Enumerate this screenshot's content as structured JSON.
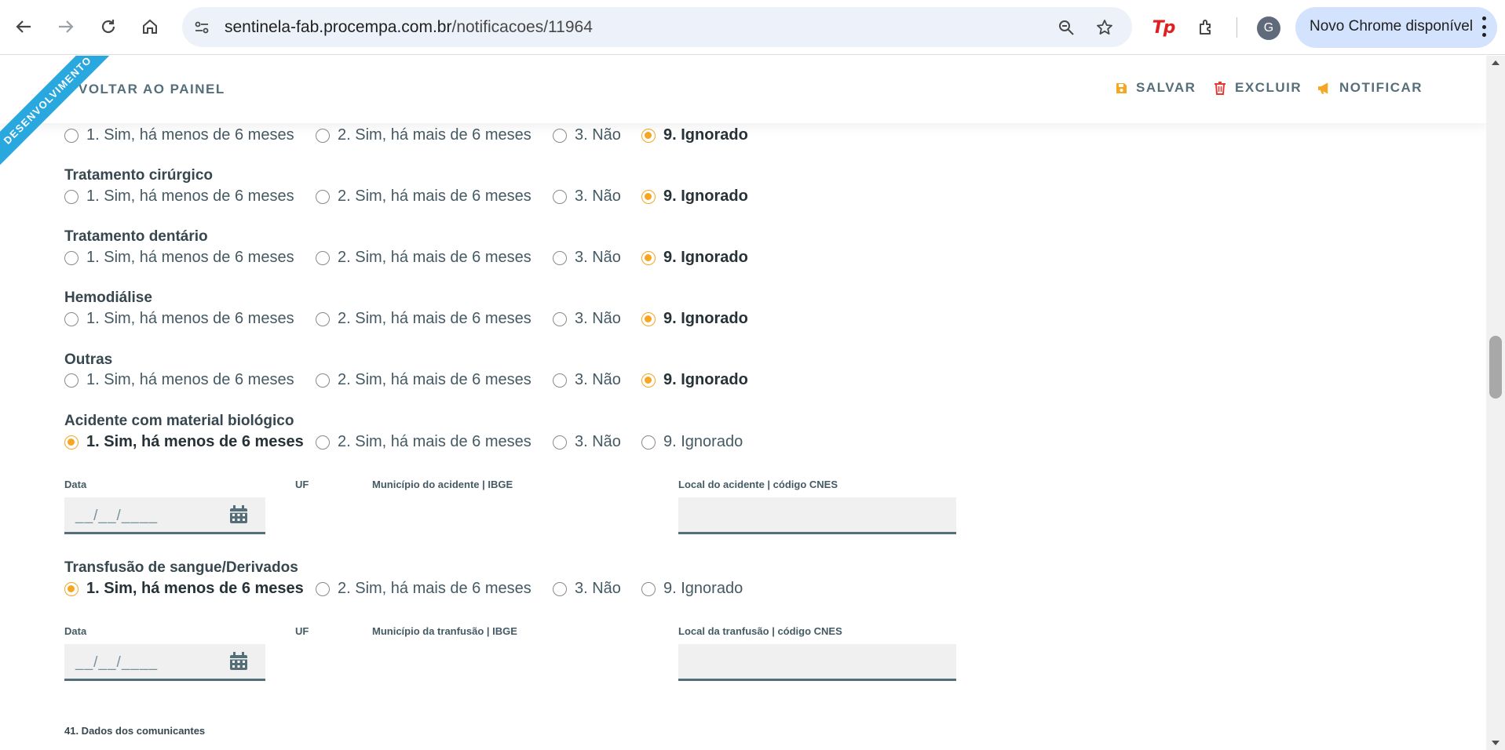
{
  "browser": {
    "url_host": "sentinela-fab.procempa.com.br",
    "url_path": "/notificacoes/11964",
    "update_label": "Novo Chrome disponível",
    "profile_initial": "G",
    "extension_label": "Tp"
  },
  "header": {
    "ribbon": "DESENVOLVIMENTO",
    "back_label": "VOLTAR AO PAINEL",
    "save_label": "SALVAR",
    "delete_label": "EXCLUIR",
    "notify_label": "NOTIFICAR",
    "accent_color": "#f5a623",
    "delete_color": "#e53935"
  },
  "options": {
    "opt1": "1. Sim, há menos de 6 meses",
    "opt2": "2. Sim, há mais de 6 meses",
    "opt3": "3. Não",
    "opt9": "9. Ignorado"
  },
  "questions": [
    {
      "label": "",
      "selected": "9"
    },
    {
      "label": "Tratamento cirúrgico",
      "selected": "9"
    },
    {
      "label": "Tratamento dentário",
      "selected": "9"
    },
    {
      "label": "Hemodiálise",
      "selected": "9"
    },
    {
      "label": "Outras",
      "selected": "9"
    },
    {
      "label": "Acidente com material biológico",
      "selected": "1"
    },
    {
      "label": "Transfusão de sangue/Derivados",
      "selected": "1"
    }
  ],
  "accident_fields": {
    "date_label": "Data",
    "date_value": "__/__/____",
    "uf_label": "UF",
    "municipio_label": "Município do acidente | IBGE",
    "local_label": "Local do acidente | código CNES"
  },
  "transfusion_fields": {
    "date_label": "Data",
    "date_value": "__/__/____",
    "uf_label": "UF",
    "municipio_label": "Município da tranfusão | IBGE",
    "local_label": "Local da tranfusão | código CNES"
  },
  "next_section": "41. Dados dos comunicantes"
}
